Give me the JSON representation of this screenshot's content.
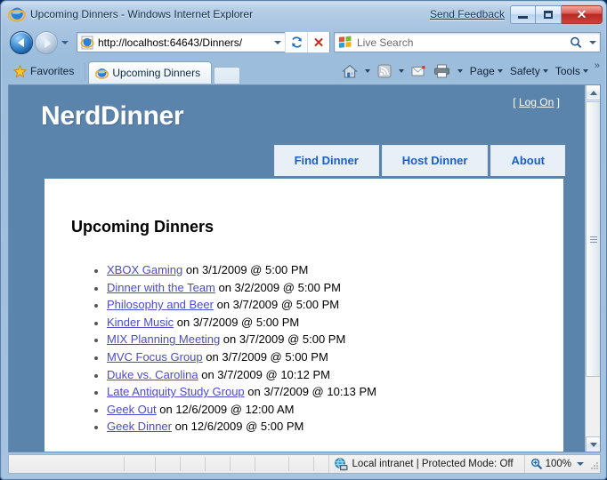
{
  "window": {
    "title": "Upcoming Dinners - Windows Internet Explorer",
    "send_feedback": "Send Feedback",
    "minimize_label": "Minimize",
    "maximize_label": "Maximize",
    "close_label": "Close",
    "close_glyph": "✕"
  },
  "navbar": {
    "url": "http://localhost:64643/Dinners/",
    "search_placeholder": "Live Search",
    "back_label": "Back",
    "forward_label": "Forward",
    "refresh_label": "Refresh",
    "stop_label": "Stop",
    "stop_glyph": "✕"
  },
  "tabbar": {
    "favorites_label": "Favorites",
    "tabs": [
      {
        "label": "Upcoming Dinners",
        "active": true
      }
    ],
    "commands": [
      {
        "label": "Page"
      },
      {
        "label": "Safety"
      },
      {
        "label": "Tools"
      }
    ],
    "overflow": "»"
  },
  "page": {
    "brand": "NerdDinner",
    "logon": {
      "open_bracket": "[",
      "link": "Log On",
      "close_bracket": "]"
    },
    "menu": [
      {
        "label": "Find Dinner"
      },
      {
        "label": "Host Dinner"
      },
      {
        "label": "About"
      }
    ],
    "heading": "Upcoming Dinners",
    "dinners": [
      {
        "title": "XBOX Gaming",
        "when": " on 3/1/2009 @ 5:00 PM"
      },
      {
        "title": "Dinner with the Team",
        "when": " on 3/2/2009 @ 5:00 PM"
      },
      {
        "title": "Philosophy and Beer",
        "when": " on 3/7/2009 @ 5:00 PM"
      },
      {
        "title": "Kinder Music",
        "when": " on 3/7/2009 @ 5:00 PM"
      },
      {
        "title": "MIX Planning Meeting",
        "when": " on 3/7/2009 @ 5:00 PM"
      },
      {
        "title": "MVC Focus Group",
        "when": " on 3/7/2009 @ 5:00 PM"
      },
      {
        "title": "Duke vs. Carolina",
        "when": " on 3/7/2009 @ 10:12 PM"
      },
      {
        "title": "Late Antiquity Study Group",
        "when": " on 3/7/2009 @ 10:13 PM"
      },
      {
        "title": "Geek Out",
        "when": " on 12/6/2009 @ 12:00 AM"
      },
      {
        "title": "Geek Dinner",
        "when": " on 12/6/2009 @ 5:00 PM"
      }
    ],
    "colors": {
      "background": "#5b84ad",
      "content": "#ffffff",
      "menu_tab_bg": "#e9eff7",
      "menu_tab_text": "#1a5fc4",
      "link": "#4a4ad0"
    }
  },
  "statusbar": {
    "zone": "Local intranet | Protected Mode: Off",
    "zoom": "100%"
  }
}
